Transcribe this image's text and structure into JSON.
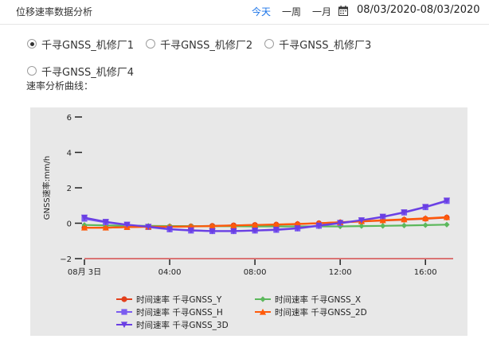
{
  "header": {
    "title": "位移速率数据分析",
    "ranges": [
      {
        "label": "今天",
        "active": true
      },
      {
        "label": "一周",
        "active": false
      },
      {
        "label": "一月",
        "active": false
      }
    ],
    "calendar_icon": "calendar-icon",
    "date_range": "08/03/2020-08/03/2020"
  },
  "stations": [
    {
      "label": "千寻GNSS_机修厂1",
      "checked": true
    },
    {
      "label": "千寻GNSS_机修厂2",
      "checked": false
    },
    {
      "label": "千寻GNSS_机修厂3",
      "checked": false
    },
    {
      "label": "千寻GNSS_机修厂4",
      "checked": false
    }
  ],
  "section_label": "速率分析曲线：",
  "colors": {
    "accent": "#1a73e8",
    "zero_line": "#cc0000",
    "plot_bg": "#e8e8e8"
  },
  "chart_data": {
    "type": "line",
    "ylabel": "GNSS速率:mm/h",
    "ylim": [
      -2,
      6
    ],
    "y_ticks": [
      -2,
      0,
      2,
      4,
      6
    ],
    "y_tick_labels": [
      "−2",
      "0",
      "2",
      "4",
      "6"
    ],
    "xlim": [
      0,
      17.3
    ],
    "x_ticks": [
      0,
      4,
      8,
      12,
      16
    ],
    "x_tick_labels": [
      "08月 3日",
      "04:00",
      "08:00",
      "12:00",
      "16:00"
    ],
    "x": [
      0,
      1,
      2,
      3,
      4,
      5,
      6,
      7,
      8,
      9,
      10,
      11,
      12,
      13,
      14,
      15,
      16,
      17
    ],
    "legend_position": "bottom",
    "series": [
      {
        "name": "时间速率 千寻GNSS_Y",
        "color": "#e2401c",
        "marker": "circle",
        "values": [
          -0.25,
          -0.25,
          -0.22,
          -0.2,
          -0.2,
          -0.18,
          -0.15,
          -0.12,
          -0.1,
          -0.08,
          -0.05,
          0.0,
          0.05,
          0.1,
          0.15,
          0.2,
          0.25,
          0.32
        ]
      },
      {
        "name": "时间速率 千寻GNSS_X",
        "color": "#5cb85c",
        "marker": "diamond",
        "values": [
          -0.1,
          -0.12,
          -0.14,
          -0.15,
          -0.16,
          -0.16,
          -0.17,
          -0.17,
          -0.18,
          -0.18,
          -0.18,
          -0.18,
          -0.18,
          -0.16,
          -0.15,
          -0.13,
          -0.11,
          -0.08
        ]
      },
      {
        "name": "时间速率 千寻GNSS_H",
        "color": "#7b5cf0",
        "marker": "square",
        "values": [
          0.25,
          0.05,
          -0.1,
          -0.22,
          -0.35,
          -0.42,
          -0.45,
          -0.45,
          -0.42,
          -0.38,
          -0.3,
          -0.15,
          0.0,
          0.15,
          0.35,
          0.6,
          0.9,
          1.25
        ]
      },
      {
        "name": "时间速率 千寻GNSS_2D",
        "color": "#ff5a0a",
        "marker": "triangle-up",
        "values": [
          -0.25,
          -0.25,
          -0.22,
          -0.2,
          -0.2,
          -0.18,
          -0.16,
          -0.13,
          -0.1,
          -0.07,
          -0.04,
          0.0,
          0.06,
          0.11,
          0.17,
          0.22,
          0.28,
          0.34
        ]
      },
      {
        "name": "时间速率 千寻GNSS_3D",
        "color": "#6a3fe3",
        "marker": "triangle-down",
        "values": [
          0.32,
          0.08,
          -0.08,
          -0.2,
          -0.33,
          -0.4,
          -0.44,
          -0.44,
          -0.41,
          -0.36,
          -0.28,
          -0.13,
          0.02,
          0.17,
          0.37,
          0.62,
          0.92,
          1.28
        ]
      }
    ]
  }
}
